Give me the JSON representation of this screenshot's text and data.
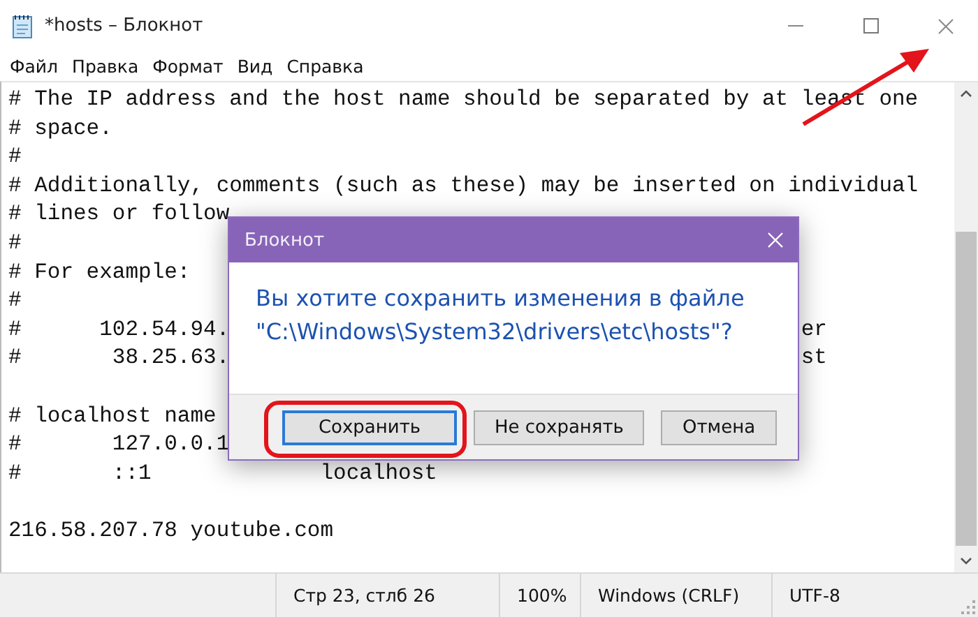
{
  "window": {
    "title": "*hosts – Блокнот"
  },
  "menu": [
    "Файл",
    "Правка",
    "Формат",
    "Вид",
    "Справка"
  ],
  "editor": {
    "blocks": [
      [
        {
          "text": "# The IP address and the host name should be separated by at least one"
        },
        {
          "text": "# space."
        },
        {
          "text": "#"
        },
        {
          "text": "# Additionally, comments (such as these) may be inserted on individual"
        },
        {
          "text": "# lines or follow"
        },
        {
          "text": "#"
        },
        {
          "text": "# For example:"
        },
        {
          "text": "#"
        },
        {
          "text": "#      102.54.94.",
          "tail": "er"
        },
        {
          "text": "#       38.25.63.",
          "tail": "st"
        }
      ],
      [
        {
          "text": "# localhost name"
        },
        {
          "text": "#       127.0.0.1"
        },
        {
          "text": "#       ::1             localhost"
        }
      ],
      [
        {
          "text": "216.58.207.78 youtube.com"
        }
      ]
    ]
  },
  "status_bar": [
    "Стр 23, стлб 26",
    "100%",
    "Windows (CRLF)",
    "UTF-8"
  ],
  "dialog": {
    "title": "Блокнот",
    "message": "Вы хотите сохранить изменения в файле \"C:\\Windows\\System32\\drivers\\etc\\hosts\"?",
    "buttons": [
      {
        "label": "Сохранить",
        "default": true
      },
      {
        "label": "Не сохранять",
        "default": false
      },
      {
        "label": "Отмена",
        "default": false
      }
    ]
  }
}
